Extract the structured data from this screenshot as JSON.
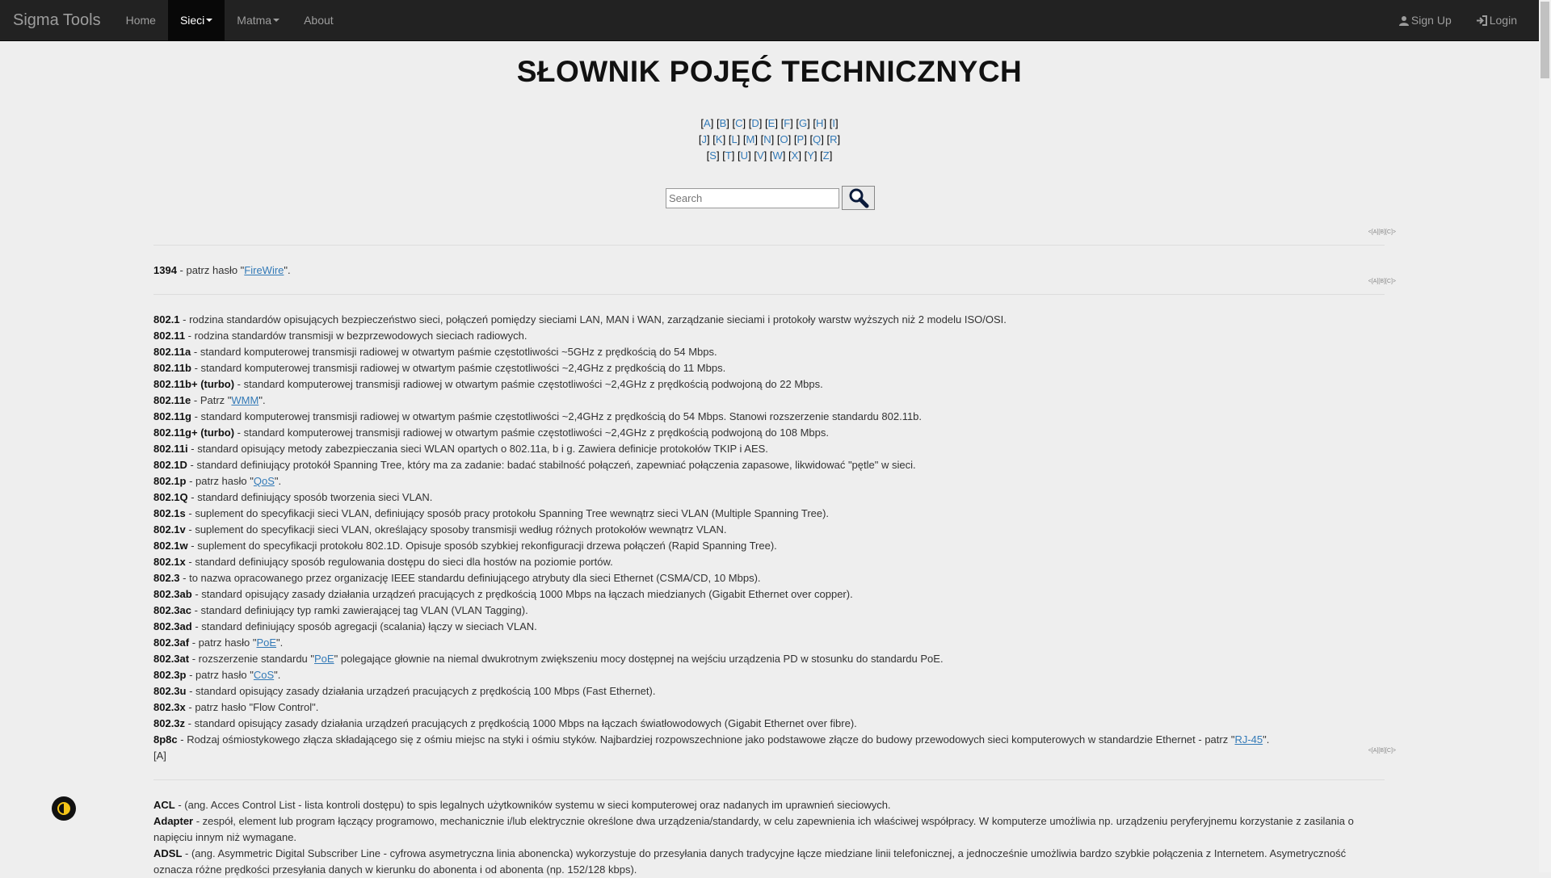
{
  "navbar": {
    "brand": "Sigma Tools",
    "items": [
      "Home",
      "Sieci",
      "Matma",
      "About"
    ],
    "signup": "Sign Up",
    "login": "Login"
  },
  "page_title": "SŁOWNIK POJĘĆ TECHNICZNYCH",
  "letters": {
    "row1": [
      "A",
      "B",
      "C",
      "D",
      "E",
      "F",
      "G",
      "H",
      "I"
    ],
    "row2": [
      "J",
      "K",
      "L",
      "M",
      "N",
      "O",
      "P",
      "Q",
      "R"
    ],
    "row3": [
      "S",
      "T",
      "U",
      "V",
      "W",
      "X",
      "Y",
      "Z"
    ]
  },
  "search": {
    "placeholder": "Search"
  },
  "mini_nav": "<[A][B][C]>",
  "sections": {
    "s1394": {
      "term": "1394",
      "text_before": " - patrz hasło \"",
      "link": "FireWire",
      "text_after": "\"."
    },
    "s802": [
      {
        "term": "802.1",
        "text": " - rodzina standardów opisujących bezpieczeństwo sieci, połączeń pomiędzy sieciami LAN, MAN i WAN, zarządzanie sieciami i protokoły warstw wyższych niż 2 modelu ISO/OSI."
      },
      {
        "term": "802.11",
        "text": " - rodzina standardów transmisji w bezprzewodowych sieciach radiowych."
      },
      {
        "term": "802.11a",
        "text": " - standard komputerowej transmisji radiowej w otwartym paśmie częstotliwości ~5GHz z prędkością do 54 Mbps."
      },
      {
        "term": "802.11b",
        "text": " - standard komputerowej transmisji radiowej w otwartym paśmie częstotliwości ~2,4GHz z prędkością do 11 Mbps."
      },
      {
        "term": "802.11b+ (turbo)",
        "text": " - standard komputerowej transmisji radiowej w otwartym paśmie częstotliwości ~2,4GHz z prędkością podwojoną do 22 Mbps."
      },
      {
        "term": "802.11e",
        "text": " - Patrz \"",
        "link": "WMM",
        "after": "\"."
      },
      {
        "term": "802.11g",
        "text": " - standard komputerowej transmisji radiowej w otwartym paśmie częstotliwości ~2,4GHz z prędkością do 54 Mbps. Stanowi rozszerzenie standardu 802.11b."
      },
      {
        "term": "802.11g+ (turbo)",
        "text": " - standard komputerowej transmisji radiowej w otwartym paśmie częstotliwości ~2,4GHz z prędkością podwojoną do 108 Mbps."
      },
      {
        "term": "802.11i",
        "text": " - standard opisujący metody zabezpieczania sieci WLAN opartych o 802.11a, b i g. Zawiera definicje protokołów TKIP i AES."
      },
      {
        "term": "802.1D",
        "text": " - standard definiujący protokół Spanning Tree, który ma za zadanie: badać stabilność połączeń, zapewniać połączenia zapasowe, likwidować \"pętle\" w sieci."
      },
      {
        "term": "802.1p",
        "text": " - patrz hasło \"",
        "link": "QoS",
        "after": "\"."
      },
      {
        "term": "802.1Q",
        "text": " - standard definiujący sposób tworzenia sieci VLAN."
      },
      {
        "term": "802.1s",
        "text": " - suplement do specyfikacji sieci VLAN, definiujący sposób pracy protokołu Spanning Tree wewnątrz sieci VLAN (Multiple Spanning Tree)."
      },
      {
        "term": "802.1v",
        "text": " - suplement do specyfikacji sieci VLAN, określający sposoby transmisji według różnych protokołów wewnątrz VLAN."
      },
      {
        "term": "802.1w",
        "text": " - suplement do specyfikacji protokołu 802.1D. Opisuje sposób szybkiej rekonfiguracji drzewa połączeń (Rapid Spanning Tree)."
      },
      {
        "term": "802.1x",
        "text": " - standard definiujący sposób regulowania dostępu do sieci dla hostów na poziomie portów."
      },
      {
        "term": "802.3",
        "text": " - to nazwa opracowanego przez organizację IEEE standardu definiującego atrybuty dla sieci Ethernet (CSMA/CD, 10 Mbps)."
      },
      {
        "term": "802.3ab",
        "text": " - standard opisujący zasady działania urządzeń pracujących z prędkością 1000 Mbps na łączach miedzianych (Gigabit Ethernet over copper)."
      },
      {
        "term": "802.3ac",
        "text": " - standard definiujący typ ramki zawierającej tag VLAN (VLAN Tagging)."
      },
      {
        "term": "802.3ad",
        "text": " - standard definiujący sposób agregacji (scalania) łączy w sieciach VLAN."
      },
      {
        "term": "802.3af",
        "text": " - patrz hasło \"",
        "link": "PoE",
        "after": "\"."
      },
      {
        "term": "802.3at",
        "text": " - rozszerzenie standardu \"",
        "link": "PoE",
        "after": "\" polegające głownie na niemal dwukrotnym zwiększeniu mocy dostępnej na wejściu urządzenia PD w stosunku do standardu PoE."
      },
      {
        "term": "802.3p",
        "text": " - patrz hasło \"",
        "link": "CoS",
        "after": "\"."
      },
      {
        "term": "802.3u",
        "text": " - standard opisujący zasady działania urządzeń pracujących z prędkością 100 Mbps (Fast Ethernet)."
      },
      {
        "term": "802.3x",
        "text": " - patrz hasło \"Flow Control\"."
      },
      {
        "term": "802.3z",
        "text": " - standard opisujący zasady działania urządzeń pracujących z prędkością 1000 Mbps na łączach światłowodowych (Gigabit Ethernet over fibre)."
      },
      {
        "term": "8p8c",
        "text": " - Rodzaj ośmiostykowego złącza składającego się z ośmiu miejsc na styki i ośmiu styków. Najbardziej rozpowszechnione jako podstawowe złącze do budowy przewodowych sieci komputerowych w standardzie Ethernet - patrz \"",
        "link": "RJ-45",
        "after": "\"."
      }
    ],
    "anchor_a": "[A]",
    "sA": [
      {
        "term": "ACL",
        "text": " - (ang. Acces Control List - lista kontroli dostępu) to spis legalnych użytkowników systemu w sieci komputerowej oraz nadanych im uprawnień sieciowych."
      },
      {
        "term": "Adapter",
        "text": " - zespół, element lub program łączący programowo, mechanicznie i/lub elektrycznie określone dwa urządzenia/standardy, w celu zapewnienia ich właściwej współpracy. W komputerze umożliwia np. urządzeniu peryferyjnemu korzystanie z zasilania o napięciu innym niż wymagane."
      },
      {
        "term": "ADSL",
        "text": " - (ang. Asymmetric Digital Subscriber Line - cyfrowa asymetryczna linia abonencka) wykorzystuje do przesyłania danych tradycyjne łącze miedziane linii telefonicznej, a jednocześnie umożliwia bardzo szybkie połączenia z Internetem. Asymetryczność oznacza różne prędkości przesyłania danych w kierunku do abonenta i od abonenta (np. 152/128 kbps)."
      }
    ]
  }
}
